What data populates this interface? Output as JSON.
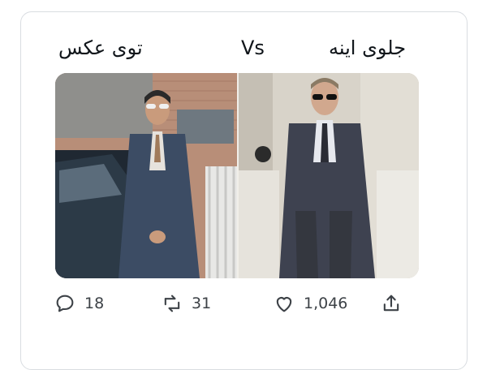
{
  "tweet": {
    "caption_left": "توی عکس",
    "caption_vs": "Vs",
    "caption_right": "جلوی اینه"
  },
  "actions": {
    "reply_count": "18",
    "retweet_count": "31",
    "like_count": "1,046"
  },
  "icons": {
    "reply": "reply-icon",
    "retweet": "retweet-icon",
    "like": "heart-icon",
    "share": "share-icon"
  },
  "colors": {
    "card_border": "#d9dde1",
    "text": "#0f1419",
    "muted": "#3d4247"
  }
}
